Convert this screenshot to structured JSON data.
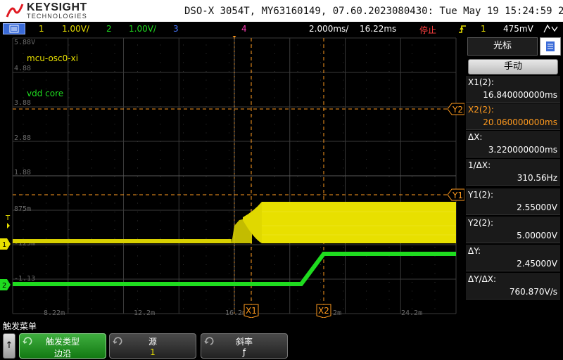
{
  "header": {
    "brand": "KEYSIGHT",
    "brand_sub": "TECHNOLOGIES",
    "model_line": "DSO-X 3054T, MY63160149, 07.60.2023080430: Tue May 19 15:24:59 2026"
  },
  "status": {
    "ch1_num": "1",
    "ch1_scale": "1.00V/",
    "ch2_num": "2",
    "ch2_scale": "1.00V/",
    "ch3_num": "3",
    "ch4_num": "4",
    "timebase": "2.000ms/",
    "delay": "16.22ms",
    "run_state": "停止",
    "trig_source": "1",
    "trig_level": "475mV",
    "colors": {
      "ch1": "#e8e000",
      "ch2": "#1fdc1f",
      "ch3": "#4a78ff",
      "ch4": "#ff3cb4",
      "cursor": "#ff9a1e",
      "state": "#ff4040"
    }
  },
  "plot": {
    "trace_labels": {
      "ch1": "mcu-osc0-xi",
      "ch2": "vdd core"
    },
    "y_ticks": [
      "5.88V",
      "4.88",
      "3.88",
      "2.88",
      "1.88",
      "875m",
      "-125m",
      "-1.13"
    ],
    "x_ticks": [
      "8.22m",
      "12.2m",
      "16.2m",
      "20.2m",
      "24.2m"
    ],
    "cursor_tags": {
      "x1": "X1",
      "x2": "X2",
      "y1": "Y1",
      "y2": "Y2"
    },
    "ch_markers": {
      "ch1": "1",
      "ch2": "2",
      "trig": "T"
    }
  },
  "side": {
    "tab": "光标",
    "mode": "手动",
    "rows": [
      {
        "label": "X1(2):",
        "value": "16.840000000ms",
        "color": "#fff"
      },
      {
        "label": "X2(2):",
        "value": "20.060000000ms",
        "color": "#ff9a1e"
      },
      {
        "label": "ΔX:",
        "value": "3.220000000ms",
        "color": "#fff"
      },
      {
        "label": "1/ΔX:",
        "value": "310.56Hz",
        "color": "#fff"
      },
      {
        "label": "Y1(2):",
        "value": "2.55000V",
        "color": "#fff"
      },
      {
        "label": "Y2(2):",
        "value": "5.00000V",
        "color": "#fff"
      },
      {
        "label": "ΔY:",
        "value": "2.45000V",
        "color": "#fff"
      },
      {
        "label": "ΔY/ΔX:",
        "value": "760.870V/s",
        "color": "#fff"
      }
    ]
  },
  "softkeys": {
    "menu_title": "触发菜单",
    "up": "↑",
    "keys": [
      {
        "title": "触发类型",
        "value": "边沿"
      },
      {
        "title": "源",
        "value": "1"
      },
      {
        "title": "斜率",
        "value": "ƒ"
      }
    ]
  }
}
